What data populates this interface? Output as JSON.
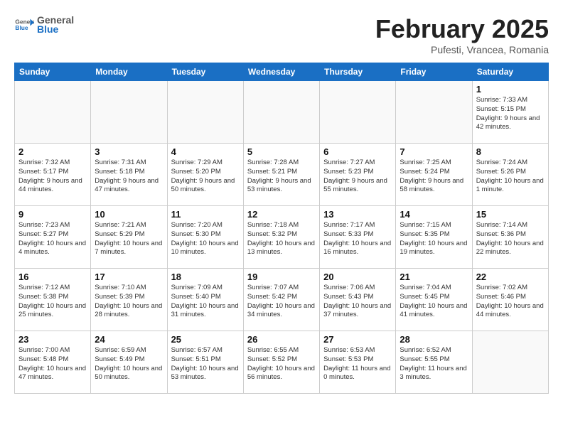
{
  "header": {
    "logo_general": "General",
    "logo_blue": "Blue",
    "month": "February 2025",
    "location": "Pufesti, Vrancea, Romania"
  },
  "days_of_week": [
    "Sunday",
    "Monday",
    "Tuesday",
    "Wednesday",
    "Thursday",
    "Friday",
    "Saturday"
  ],
  "weeks": [
    [
      {
        "num": "",
        "info": ""
      },
      {
        "num": "",
        "info": ""
      },
      {
        "num": "",
        "info": ""
      },
      {
        "num": "",
        "info": ""
      },
      {
        "num": "",
        "info": ""
      },
      {
        "num": "",
        "info": ""
      },
      {
        "num": "1",
        "info": "Sunrise: 7:33 AM\nSunset: 5:15 PM\nDaylight: 9 hours and 42 minutes."
      }
    ],
    [
      {
        "num": "2",
        "info": "Sunrise: 7:32 AM\nSunset: 5:17 PM\nDaylight: 9 hours and 44 minutes."
      },
      {
        "num": "3",
        "info": "Sunrise: 7:31 AM\nSunset: 5:18 PM\nDaylight: 9 hours and 47 minutes."
      },
      {
        "num": "4",
        "info": "Sunrise: 7:29 AM\nSunset: 5:20 PM\nDaylight: 9 hours and 50 minutes."
      },
      {
        "num": "5",
        "info": "Sunrise: 7:28 AM\nSunset: 5:21 PM\nDaylight: 9 hours and 53 minutes."
      },
      {
        "num": "6",
        "info": "Sunrise: 7:27 AM\nSunset: 5:23 PM\nDaylight: 9 hours and 55 minutes."
      },
      {
        "num": "7",
        "info": "Sunrise: 7:25 AM\nSunset: 5:24 PM\nDaylight: 9 hours and 58 minutes."
      },
      {
        "num": "8",
        "info": "Sunrise: 7:24 AM\nSunset: 5:26 PM\nDaylight: 10 hours and 1 minute."
      }
    ],
    [
      {
        "num": "9",
        "info": "Sunrise: 7:23 AM\nSunset: 5:27 PM\nDaylight: 10 hours and 4 minutes."
      },
      {
        "num": "10",
        "info": "Sunrise: 7:21 AM\nSunset: 5:29 PM\nDaylight: 10 hours and 7 minutes."
      },
      {
        "num": "11",
        "info": "Sunrise: 7:20 AM\nSunset: 5:30 PM\nDaylight: 10 hours and 10 minutes."
      },
      {
        "num": "12",
        "info": "Sunrise: 7:18 AM\nSunset: 5:32 PM\nDaylight: 10 hours and 13 minutes."
      },
      {
        "num": "13",
        "info": "Sunrise: 7:17 AM\nSunset: 5:33 PM\nDaylight: 10 hours and 16 minutes."
      },
      {
        "num": "14",
        "info": "Sunrise: 7:15 AM\nSunset: 5:35 PM\nDaylight: 10 hours and 19 minutes."
      },
      {
        "num": "15",
        "info": "Sunrise: 7:14 AM\nSunset: 5:36 PM\nDaylight: 10 hours and 22 minutes."
      }
    ],
    [
      {
        "num": "16",
        "info": "Sunrise: 7:12 AM\nSunset: 5:38 PM\nDaylight: 10 hours and 25 minutes."
      },
      {
        "num": "17",
        "info": "Sunrise: 7:10 AM\nSunset: 5:39 PM\nDaylight: 10 hours and 28 minutes."
      },
      {
        "num": "18",
        "info": "Sunrise: 7:09 AM\nSunset: 5:40 PM\nDaylight: 10 hours and 31 minutes."
      },
      {
        "num": "19",
        "info": "Sunrise: 7:07 AM\nSunset: 5:42 PM\nDaylight: 10 hours and 34 minutes."
      },
      {
        "num": "20",
        "info": "Sunrise: 7:06 AM\nSunset: 5:43 PM\nDaylight: 10 hours and 37 minutes."
      },
      {
        "num": "21",
        "info": "Sunrise: 7:04 AM\nSunset: 5:45 PM\nDaylight: 10 hours and 41 minutes."
      },
      {
        "num": "22",
        "info": "Sunrise: 7:02 AM\nSunset: 5:46 PM\nDaylight: 10 hours and 44 minutes."
      }
    ],
    [
      {
        "num": "23",
        "info": "Sunrise: 7:00 AM\nSunset: 5:48 PM\nDaylight: 10 hours and 47 minutes."
      },
      {
        "num": "24",
        "info": "Sunrise: 6:59 AM\nSunset: 5:49 PM\nDaylight: 10 hours and 50 minutes."
      },
      {
        "num": "25",
        "info": "Sunrise: 6:57 AM\nSunset: 5:51 PM\nDaylight: 10 hours and 53 minutes."
      },
      {
        "num": "26",
        "info": "Sunrise: 6:55 AM\nSunset: 5:52 PM\nDaylight: 10 hours and 56 minutes."
      },
      {
        "num": "27",
        "info": "Sunrise: 6:53 AM\nSunset: 5:53 PM\nDaylight: 11 hours and 0 minutes."
      },
      {
        "num": "28",
        "info": "Sunrise: 6:52 AM\nSunset: 5:55 PM\nDaylight: 11 hours and 3 minutes."
      },
      {
        "num": "",
        "info": ""
      }
    ]
  ]
}
